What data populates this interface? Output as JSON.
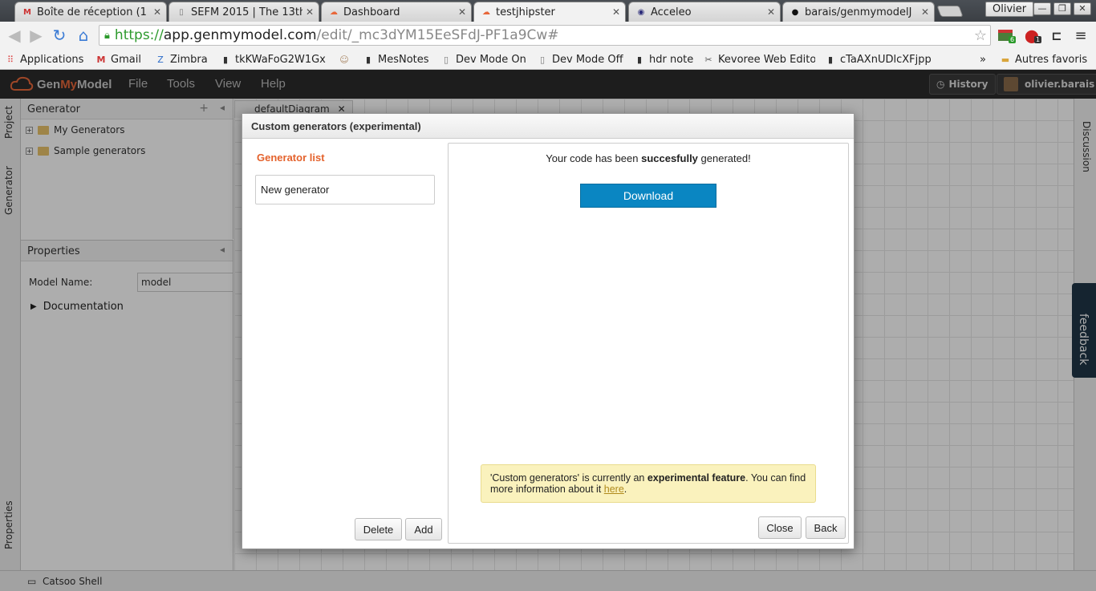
{
  "browser": {
    "tabs": [
      {
        "title": "Boîte de réception (1",
        "favicon": "gmail-icon"
      },
      {
        "title": "SEFM 2015 | The 13th",
        "favicon": "page-icon"
      },
      {
        "title": "Dashboard",
        "favicon": "genmymodel-icon"
      },
      {
        "title": "testjhipster",
        "favicon": "genmymodel-icon"
      },
      {
        "title": "Acceleo",
        "favicon": "eclipse-icon"
      },
      {
        "title": "barais/genmymodelJ",
        "favicon": "github-icon"
      }
    ],
    "profile_name": "Olivier",
    "url": {
      "scheme": "https://",
      "host": "app.genmymodel.com",
      "path": "/edit/_mc3dYM15EeSFdJ-PF1a9Cw#"
    },
    "extension_badges": [
      "6",
      "1"
    ],
    "bookmarks": [
      "Applications",
      "Gmail",
      "Zimbra",
      "tkKWaFoG2W1Gx",
      "",
      "MesNotes",
      "Dev Mode On",
      "Dev Mode Off",
      "hdr note",
      "Kevoree Web Edito",
      "cTaAXnUDlcXFjpp"
    ],
    "bookmarks_more": "»",
    "other_bookmarks": "Autres favoris"
  },
  "app": {
    "logo_prefix": "Gen",
    "logo_accent": "My",
    "logo_suffix": "Model",
    "menus": [
      "File",
      "Tools",
      "View",
      "Help"
    ],
    "history_label": "History",
    "user_label": "olivier.barais"
  },
  "workspace": {
    "left_tabs": [
      "Project",
      "Generator",
      "Properties"
    ],
    "generator_panel_title": "Generator",
    "generator_tree": [
      "My Generators",
      "Sample generators"
    ],
    "properties_panel_title": "Properties",
    "model_name_label": "Model Name:",
    "model_name_value": "model",
    "documentation_label": "Documentation",
    "diagram_tab": "defaultDiagram",
    "right_tab": "Discussion",
    "feedback_label": "feedback",
    "footer_label": "Catsoo Shell"
  },
  "modal": {
    "title": "Custom generators (experimental)",
    "list_title": "Generator list",
    "generator_item": "New generator",
    "delete_label": "Delete",
    "add_label": "Add",
    "success_prefix": "Your code has been ",
    "success_bold": "succesfully",
    "success_suffix": " generated!",
    "download_label": "Download",
    "notice_prefix": "'Custom generators' is currently an ",
    "notice_bold": "experimental feature",
    "notice_middle": ". You can find more information about it ",
    "notice_link": "here",
    "notice_end": ".",
    "close_label": "Close",
    "back_label": "Back"
  },
  "colors": {
    "accent_orange": "#e4622c",
    "download_blue": "#0a86c2",
    "notice_yellow": "#faf2bd",
    "header_dark": "#2b2b2b"
  }
}
